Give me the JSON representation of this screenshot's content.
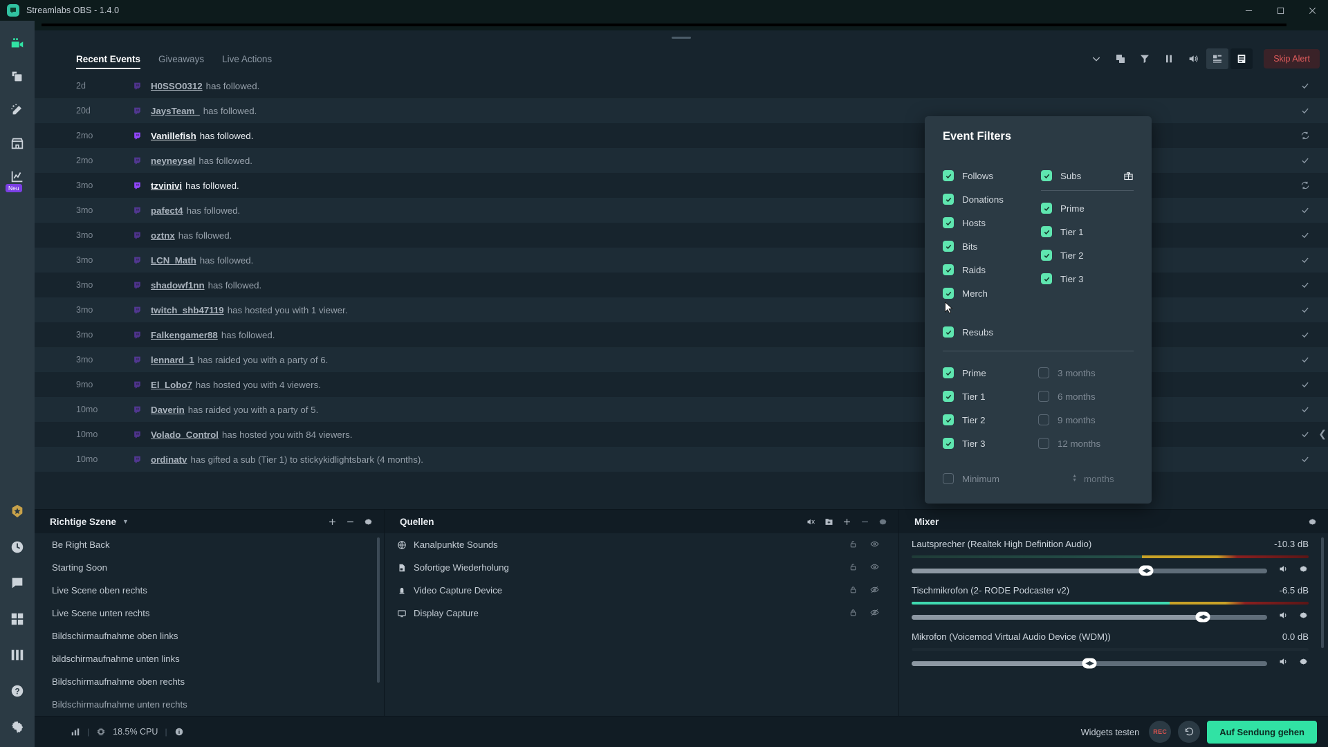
{
  "window": {
    "title": "Streamlabs OBS - 1.4.0",
    "controls": {
      "minimize": "minimize-icon",
      "maximize": "maximize-icon",
      "close": "close-icon"
    }
  },
  "rail": {
    "items": [
      {
        "name": "editor",
        "icon": "video-camera-icon",
        "badge": ""
      },
      {
        "name": "themes",
        "icon": "copy-layers-icon",
        "badge": ""
      },
      {
        "name": "alertbox",
        "icon": "magic-wand-icon",
        "badge": ""
      },
      {
        "name": "store",
        "icon": "storefront-icon",
        "badge": ""
      },
      {
        "name": "dashboard",
        "icon": "chart-line-icon",
        "badge": "Neu"
      }
    ],
    "bottom": [
      {
        "name": "prime",
        "icon": "prime-badge-icon"
      },
      {
        "name": "moon",
        "icon": "moon-icon"
      },
      {
        "name": "chat",
        "icon": "chat-bubble-icon"
      },
      {
        "name": "grid",
        "icon": "grid-icon"
      },
      {
        "name": "layout",
        "icon": "columns-icon"
      },
      {
        "name": "help",
        "icon": "question-circle-icon"
      },
      {
        "name": "settings",
        "icon": "gear-icon"
      }
    ]
  },
  "events": {
    "tabs": [
      {
        "label": "Recent Events",
        "active": true
      },
      {
        "label": "Giveaways",
        "active": false
      },
      {
        "label": "Live Actions",
        "active": false
      }
    ],
    "toolbar": [
      {
        "name": "chevron-down-icon",
        "boxed": "none"
      },
      {
        "name": "popout-icon",
        "boxed": "none"
      },
      {
        "name": "filter-icon",
        "boxed": "none"
      },
      {
        "name": "pause-icon",
        "boxed": "none"
      },
      {
        "name": "volume-icon",
        "boxed": "none"
      },
      {
        "name": "layout-compact-icon",
        "boxed": "light"
      },
      {
        "name": "layout-list-icon",
        "boxed": "dark"
      }
    ],
    "skip_alert_label": "Skip Alert",
    "rows": [
      {
        "time": "2d",
        "user": "H0SSO0312",
        "text": "has followed.",
        "highlighted": false
      },
      {
        "time": "20d",
        "user": "JaysTeam_",
        "text": "has followed.",
        "highlighted": false
      },
      {
        "time": "2mo",
        "user": "Vanillefish",
        "text": "has followed.",
        "highlighted": true
      },
      {
        "time": "2mo",
        "user": "neyneysel",
        "text": "has followed.",
        "highlighted": false
      },
      {
        "time": "3mo",
        "user": "tzvinivi",
        "text": "has followed.",
        "highlighted": true
      },
      {
        "time": "3mo",
        "user": "pafect4",
        "text": "has followed.",
        "highlighted": false
      },
      {
        "time": "3mo",
        "user": "oztnx",
        "text": "has followed.",
        "highlighted": false
      },
      {
        "time": "3mo",
        "user": "LCN_Math",
        "text": "has followed.",
        "highlighted": false
      },
      {
        "time": "3mo",
        "user": "shadowf1nn",
        "text": "has followed.",
        "highlighted": false
      },
      {
        "time": "3mo",
        "user": "twitch_shb47119",
        "text": "has hosted you with 1 viewer.",
        "highlighted": false
      },
      {
        "time": "3mo",
        "user": "Falkengamer88",
        "text": "has followed.",
        "highlighted": false
      },
      {
        "time": "3mo",
        "user": "lennard_1",
        "text": "has raided you with a party of 6.",
        "highlighted": false
      },
      {
        "time": "9mo",
        "user": "El_Lobo7",
        "text": "has hosted you with 4 viewers.",
        "highlighted": false
      },
      {
        "time": "10mo",
        "user": "Daverin",
        "text": "has raided you with a party of 5.",
        "highlighted": false
      },
      {
        "time": "10mo",
        "user": "Volado_Control",
        "text": "has hosted you with 84 viewers.",
        "highlighted": false
      },
      {
        "time": "10mo",
        "user": "ordinatv",
        "text": "has gifted a sub (Tier 1) to stickykidlightsbark (4 months).",
        "highlighted": false
      }
    ]
  },
  "event_filters": {
    "title": "Event Filters",
    "left": [
      {
        "label": "Follows",
        "checked": true
      },
      {
        "label": "Donations",
        "checked": true
      },
      {
        "label": "Hosts",
        "checked": true
      },
      {
        "label": "Bits",
        "checked": true
      },
      {
        "label": "Raids",
        "checked": true
      },
      {
        "label": "Merch",
        "checked": true
      }
    ],
    "subs": {
      "label": "Subs",
      "checked": true,
      "gift_icon": "gift-icon"
    },
    "sub_tiers": [
      {
        "label": "Prime",
        "checked": true
      },
      {
        "label": "Tier 1",
        "checked": true
      },
      {
        "label": "Tier 2",
        "checked": true
      },
      {
        "label": "Tier 3",
        "checked": true
      }
    ],
    "resubs": {
      "label": "Resubs",
      "checked": true
    },
    "resub_tiers": [
      {
        "label": "Prime",
        "checked": true
      },
      {
        "label": "Tier 1",
        "checked": true
      },
      {
        "label": "Tier 2",
        "checked": true
      },
      {
        "label": "Tier 3",
        "checked": true
      }
    ],
    "resub_months": [
      {
        "label": "3 months",
        "checked": false
      },
      {
        "label": "6 months",
        "checked": false
      },
      {
        "label": "9 months",
        "checked": false
      },
      {
        "label": "12 months",
        "checked": false
      }
    ],
    "minimum": {
      "label": "Minimum",
      "checked": false,
      "value": "",
      "unit": "months"
    }
  },
  "scenes": {
    "title": "Richtige Szene",
    "add_label": "add-scene",
    "remove_label": "remove-scene",
    "settings_label": "scene-settings",
    "items": [
      "Be Right Back",
      "Starting Soon",
      "Live Scene oben rechts",
      "Live Scene unten rechts",
      "Bildschirmaufnahme oben links",
      "bildschirmaufnahme unten links",
      "Bildschirmaufnahme oben rechts",
      "Bildschirmaufnahme unten rechts"
    ]
  },
  "sources": {
    "title": "Quellen",
    "items": [
      {
        "label": "Kanalpunkte Sounds",
        "icon": "globe-icon",
        "lock": "unlocked-icon",
        "visible": "eye-icon"
      },
      {
        "label": "Sofortige Wiederholung",
        "icon": "file-icon",
        "lock": "unlocked-icon",
        "visible": "eye-icon"
      },
      {
        "label": "Video Capture Device",
        "icon": "webcam-icon",
        "lock": "lock-icon",
        "visible": "eye-off-icon"
      },
      {
        "label": "Display Capture",
        "icon": "monitor-icon",
        "lock": "lock-icon",
        "visible": "eye-off-icon"
      }
    ]
  },
  "mixer": {
    "title": "Mixer",
    "settings_label": "mixer-settings",
    "channels": [
      {
        "name": "Lautsprecher (Realtek High Definition Audio)",
        "db": "-10.3 dB",
        "volume_pct": 66,
        "meter_pct": 82,
        "meter_green_pct": 0
      },
      {
        "name": "Tischmikrofon (2- RODE Podcaster v2)",
        "db": "-6.5 dB",
        "volume_pct": 82,
        "meter_pct": 84,
        "meter_green_pct": 65
      },
      {
        "name": "Mikrofon (Voicemod Virtual Audio Device (WDM))",
        "db": "0.0 dB",
        "volume_pct": 50,
        "meter_pct": 0,
        "meter_green_pct": 0
      }
    ]
  },
  "statusbar": {
    "performance_icon": "bars-icon",
    "cpu_icon": "cpu-icon",
    "cpu": "18.5% CPU",
    "info_icon": "info-icon",
    "widgets_label": "Widgets testen",
    "rec_label": "REC",
    "replay_icon": "replay-icon",
    "go_live_label": "Auf Sendung gehen"
  },
  "colors": {
    "accent": "#31e2a4",
    "check": "#5fe6b0",
    "panel": "#2b3a44",
    "background": "#17242d",
    "dark": "#111c24",
    "twitch": "#9146ff",
    "danger": "#e05c5c"
  }
}
